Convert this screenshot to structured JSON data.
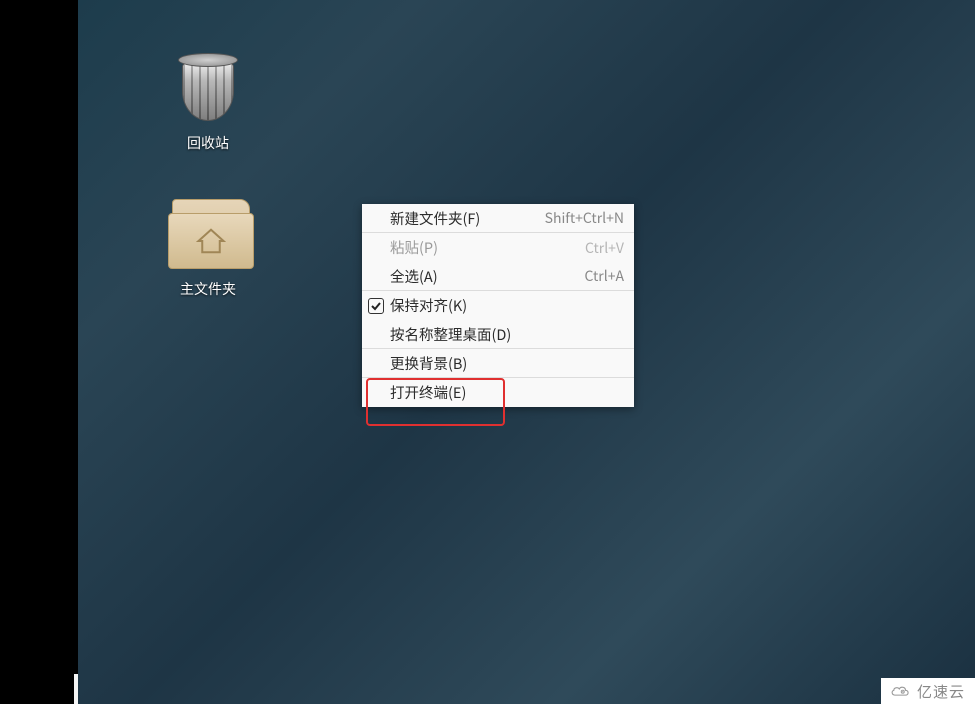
{
  "desktop": {
    "trash_label": "回收站",
    "home_label": "主文件夹"
  },
  "context_menu": {
    "items": [
      {
        "label": "新建文件夹(F)",
        "shortcut": "Shift+Ctrl+N",
        "disabled": false,
        "checked": false
      },
      {
        "label": "粘贴(P)",
        "shortcut": "Ctrl+V",
        "disabled": true,
        "checked": false
      },
      {
        "label": "全选(A)",
        "shortcut": "Ctrl+A",
        "disabled": false,
        "checked": false
      },
      {
        "label": "保持对齐(K)",
        "shortcut": "",
        "disabled": false,
        "checked": true
      },
      {
        "label": "按名称整理桌面(D)",
        "shortcut": "",
        "disabled": false,
        "checked": false
      },
      {
        "label": "更换背景(B)",
        "shortcut": "",
        "disabled": false,
        "checked": false
      },
      {
        "label": "打开终端(E)",
        "shortcut": "",
        "disabled": false,
        "checked": false
      }
    ]
  },
  "watermark": {
    "text": "亿速云"
  }
}
